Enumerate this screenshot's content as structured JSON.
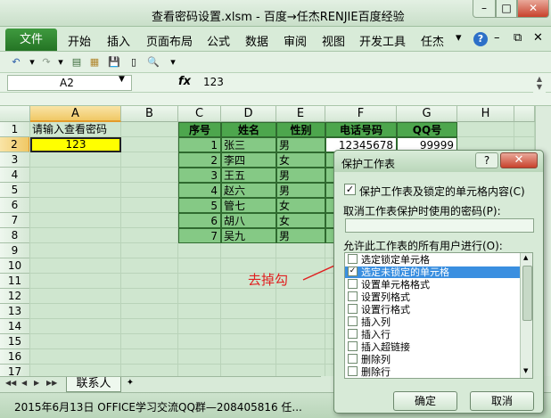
{
  "window": {
    "title": "查看密码设置.xlsm - 百度→任杰RENJIE百度经验",
    "min_glyph": "–",
    "max_glyph": "□",
    "close_glyph": "✕"
  },
  "ribbon": {
    "file_tab": "文件",
    "tabs": [
      "开始",
      "插入",
      "页面布局",
      "公式",
      "数据",
      "审阅",
      "视图",
      "开发工具",
      "任杰"
    ],
    "chevron_glyph": "▾",
    "help_glyph": "?",
    "min_glyph": "–",
    "restore_glyph": "⧉",
    "close_glyph": "✕"
  },
  "qat": {
    "icons": [
      "undo-icon",
      "dropdown-icon",
      "redo-icon",
      "dropdown-icon",
      "form-icon",
      "form2-icon",
      "save-icon",
      "new-icon",
      "print-preview-icon",
      "customize-icon"
    ],
    "glyphs": [
      "↶",
      "▾",
      "↷",
      "▾",
      "▤",
      "▦",
      "💾",
      "▯",
      "🔍",
      "▾"
    ]
  },
  "formula_bar": {
    "name_box": "A2",
    "fx": "fx",
    "value": "123"
  },
  "sheet": {
    "columns": [
      "A",
      "B",
      "C",
      "D",
      "E",
      "F",
      "G",
      "H"
    ],
    "rows": [
      "1",
      "2",
      "3",
      "4",
      "5",
      "6",
      "7",
      "8",
      "9",
      "10",
      "11",
      "12",
      "13",
      "14",
      "15",
      "16",
      "17"
    ],
    "a1": "请输入查看密码",
    "a2": "123",
    "headers": [
      "序号",
      "姓名",
      "性别",
      "电话号码",
      "QQ号"
    ],
    "records": [
      {
        "no": "1",
        "name": "张三",
        "sex": "男",
        "phone": "12345678",
        "qq": "99999"
      },
      {
        "no": "2",
        "name": "李四",
        "sex": "女",
        "phone": "",
        "qq": ""
      },
      {
        "no": "3",
        "name": "王五",
        "sex": "男",
        "phone": "",
        "qq": ""
      },
      {
        "no": "4",
        "name": "赵六",
        "sex": "男",
        "phone": "",
        "qq": ""
      },
      {
        "no": "5",
        "name": "管七",
        "sex": "女",
        "phone": "",
        "qq": ""
      },
      {
        "no": "6",
        "name": "胡八",
        "sex": "女",
        "phone": "",
        "qq": ""
      },
      {
        "no": "7",
        "name": "吴九",
        "sex": "男",
        "phone": "",
        "qq": ""
      }
    ]
  },
  "sheet_tabs": {
    "nav": [
      "◀◀",
      "◀",
      "▶",
      "▶▶"
    ],
    "active": "联系人"
  },
  "status_bar": {
    "text": "2015年6月13日    OFFICE学习交流QQ群—208405816  任..."
  },
  "annotation": {
    "text": "去掉勾",
    "color": "#e02020"
  },
  "dialog": {
    "title": "保护工作表",
    "help_glyph": "?",
    "close_glyph": "✕",
    "protect_label": "保护工作表及锁定的单元格内容(C)",
    "password_label": "取消工作表保护时使用的密码(P):",
    "password_value": "",
    "allow_label": "允许此工作表的所有用户进行(O):",
    "permissions": [
      {
        "label": "选定锁定单元格",
        "checked": false
      },
      {
        "label": "选定未锁定的单元格",
        "checked": true
      },
      {
        "label": "设置单元格格式",
        "checked": false
      },
      {
        "label": "设置列格式",
        "checked": false
      },
      {
        "label": "设置行格式",
        "checked": false
      },
      {
        "label": "插入列",
        "checked": false
      },
      {
        "label": "插入行",
        "checked": false
      },
      {
        "label": "插入超链接",
        "checked": false
      },
      {
        "label": "删除列",
        "checked": false
      },
      {
        "label": "删除行",
        "checked": false
      }
    ],
    "ok": "确定",
    "cancel": "取消"
  },
  "colors": {
    "header_green": "#4da64d",
    "table_green": "#85c985",
    "selected_yellow": "#ffff00",
    "highlight_blue": "#3a8fe0"
  }
}
